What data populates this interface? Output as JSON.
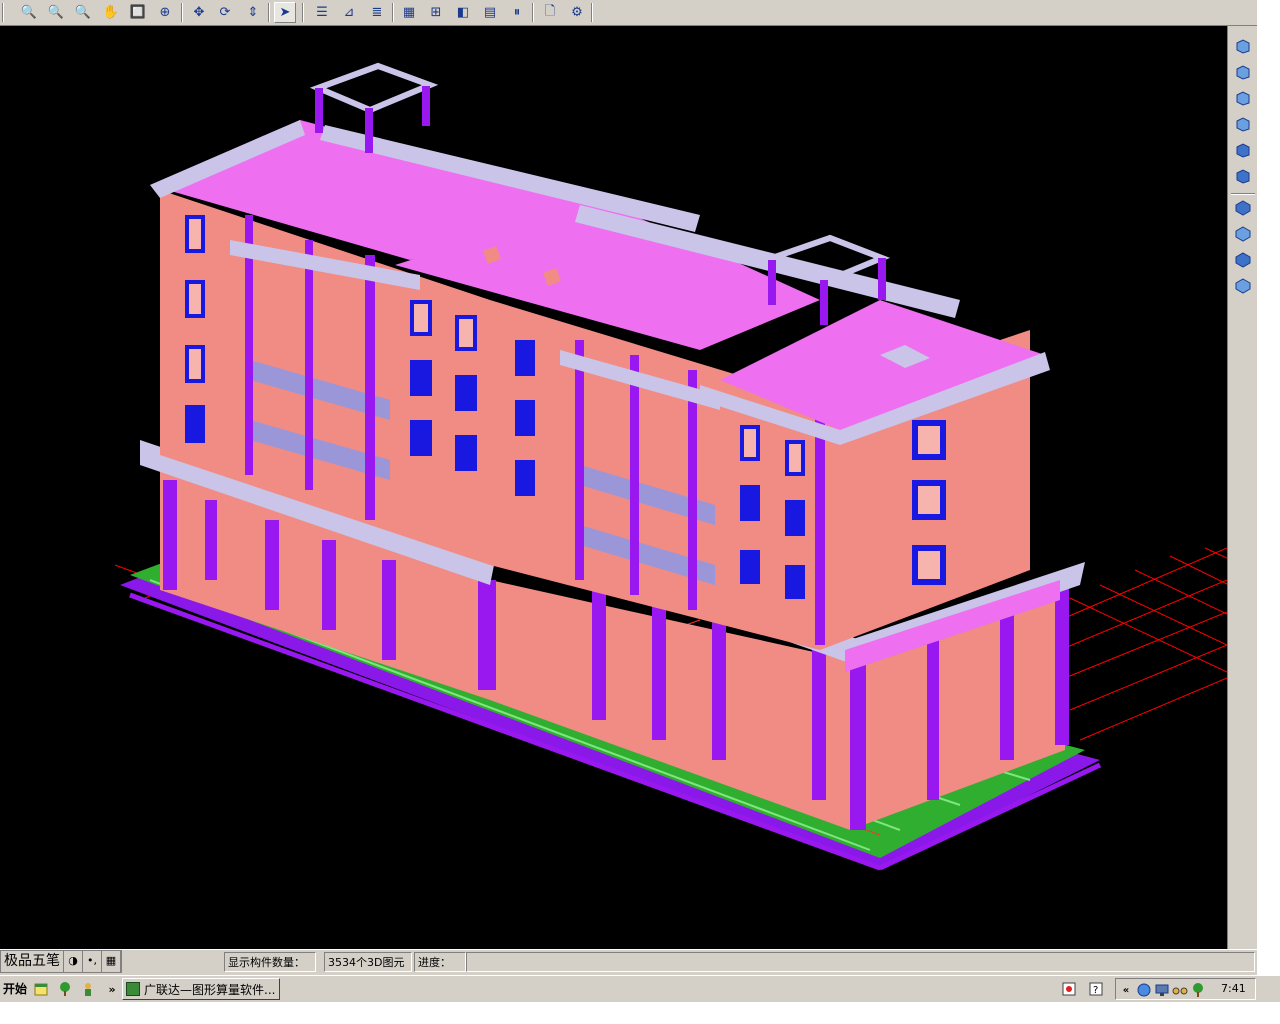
{
  "toolbar": {
    "buttons": [
      {
        "name": "zoom-in-icon",
        "glyph": "🔍"
      },
      {
        "name": "zoom-out-icon",
        "glyph": "🔍"
      },
      {
        "name": "zoom-realtime-icon",
        "glyph": "🔍"
      },
      {
        "name": "zoom-pan-icon",
        "glyph": "✋"
      },
      {
        "name": "zoom-window-icon",
        "glyph": "🔲"
      },
      {
        "name": "zoom-extents-icon",
        "glyph": "⊕"
      },
      {
        "name": "pan-icon",
        "glyph": "✥"
      },
      {
        "name": "orbit-icon",
        "glyph": "⟳"
      },
      {
        "name": "move-icon",
        "glyph": "⇕"
      },
      {
        "name": "select-icon",
        "glyph": "➤"
      },
      {
        "name": "layer-icon",
        "glyph": "☰"
      },
      {
        "name": "axis-icon",
        "glyph": "⊿"
      },
      {
        "name": "list-icon",
        "glyph": "≣"
      },
      {
        "name": "grid-icon",
        "glyph": "▦"
      },
      {
        "name": "table-edit-icon",
        "glyph": "⊞"
      },
      {
        "name": "view-3d-icon",
        "glyph": "◧"
      },
      {
        "name": "properties-icon",
        "glyph": "▤"
      },
      {
        "name": "pause-icon",
        "glyph": "⏸"
      },
      {
        "name": "preview-icon",
        "glyph": "🗋"
      },
      {
        "name": "settings-icon",
        "glyph": "⚙"
      }
    ]
  },
  "right_panel": {
    "buttons": [
      "top-view-icon",
      "bottom-view-icon",
      "left-view-icon",
      "right-view-icon",
      "front-view-icon",
      "back-view-icon",
      "sw-iso-icon",
      "se-iso-icon",
      "ne-iso-icon",
      "nw-iso-icon"
    ]
  },
  "status": {
    "ime_name": "极品五笔",
    "ime_moon": "◑",
    "ime_punct": "•,",
    "ime_keyboard": "▦",
    "count_label": "显示构件数量：",
    "count_value": "3534个3D图元",
    "progress_label": "进度：",
    "progress_value": ""
  },
  "taskbar": {
    "start_label": "开始",
    "quick_launch_more": "»",
    "task_label": "广联达—图形算量软件...",
    "tray_expand": "«",
    "clock": "7:41"
  },
  "colors": {
    "viewport_bg": "#000000",
    "wall": "#f08c84",
    "roof": "#ee6ff0",
    "column": "#9a18f0",
    "foundation": "#2fae2f",
    "trim": "#c9c4e8",
    "window": "#1818e0",
    "grid": "#ff0000"
  }
}
